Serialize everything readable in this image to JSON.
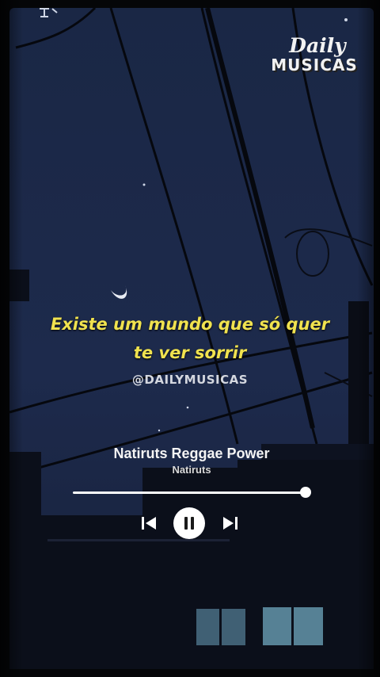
{
  "brand": {
    "line1": "Daily",
    "line2": "MUSICAS"
  },
  "lyrics": {
    "line1": "Existe um mundo que só quer",
    "line2": "te ver sorrir",
    "handle": "@DAILYMUSICAS"
  },
  "player": {
    "title": "Natiruts Reggae Power",
    "artist": "Natiruts",
    "progress": 1.0,
    "controls": {
      "previous": "skip-previous-icon",
      "play_pause": "pause-icon",
      "next": "skip-next-icon"
    }
  },
  "colors": {
    "lyric": "#f0e24f",
    "sky": "#1b2848",
    "controls": "#ffffff"
  }
}
